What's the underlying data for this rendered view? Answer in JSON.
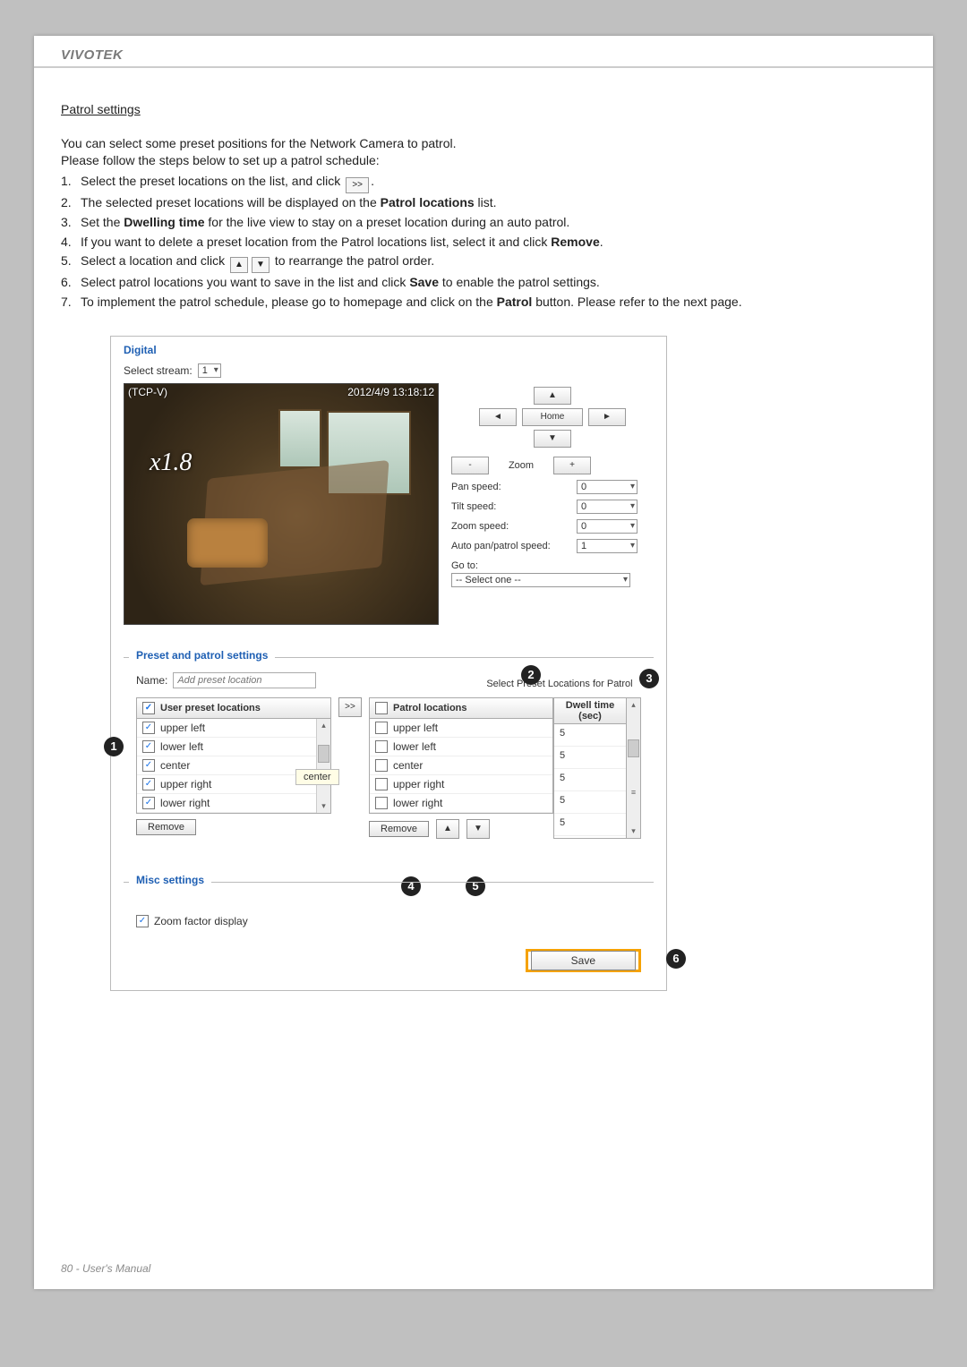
{
  "brand": "VIVOTEK",
  "footer": "80 - User's Manual",
  "title": "Patrol settings",
  "intro1": "You can select some preset positions for the Network Camera to patrol.",
  "intro2": "Please follow the steps below to set up a patrol schedule:",
  "steps": {
    "s1a": "Select the preset locations on the list, and click ",
    "s1b": ".",
    "s2a": "The selected preset locations will be displayed on the ",
    "s2b": "Patrol locations",
    "s2c": " list.",
    "s3a": "Set the ",
    "s3b": "Dwelling time",
    "s3c": " for the live view to stay on a preset location during an auto patrol.",
    "s4a": "If you want to delete a preset location from the Patrol locations list, select it and click ",
    "s4b": "Remove",
    "s4c": ".",
    "s5a": "Select a location and click ",
    "s5b": " to rearrange the patrol order.",
    "s6a": "Select patrol locations you want to save in the list and click ",
    "s6b": "Save",
    "s6c": " to enable the patrol settings.",
    "s7a": "To implement the patrol schedule, please go to homepage and click on the ",
    "s7b": "Patrol",
    "s7c": " button. Please refer to the next page."
  },
  "nums": {
    "n1": "1.",
    "n2": "2.",
    "n3": "3.",
    "n4": "4.",
    "n5": "5.",
    "n6": "6.",
    "n7": "7."
  },
  "shot": {
    "tab": "Digital",
    "selectStreamLbl": "Select stream:",
    "selectStreamVal": "1",
    "overlayLeft": "(TCP-V)",
    "overlayRight": "2012/4/9 13:18:12",
    "zoomOverlay": "x1.8",
    "homeBtn": "Home",
    "zoomLabel": "Zoom",
    "speeds": {
      "pan": {
        "lbl": "Pan speed:",
        "val": "0"
      },
      "tilt": {
        "lbl": "Tilt speed:",
        "val": "0"
      },
      "zoom": {
        "lbl": "Zoom speed:",
        "val": "0"
      },
      "auto": {
        "lbl": "Auto pan/patrol speed:",
        "val": "1"
      }
    },
    "gotoLbl": "Go to:",
    "gotoVal": "-- Select one --",
    "presetLegend": "Preset and patrol settings",
    "nameLbl": "Name:",
    "namePlaceholder": "Add preset location",
    "patrolLabel": "Select Preset Locations for Patrol",
    "userHead": "User preset locations",
    "patrolHead": "Patrol locations",
    "dwellHead1": "Dwell time",
    "dwellHead2": "(sec)",
    "user_presets": [
      "upper left",
      "lower left",
      "center",
      "upper right",
      "lower right"
    ],
    "patrol_locations": [
      {
        "name": "upper left",
        "dwell": "5"
      },
      {
        "name": "lower left",
        "dwell": "5"
      },
      {
        "name": "center",
        "dwell": "5"
      },
      {
        "name": "upper right",
        "dwell": "5"
      },
      {
        "name": "lower right",
        "dwell": "5"
      }
    ],
    "tooltip": "center",
    "removeBtn": "Remove",
    "miscLegend": "Misc settings",
    "miscCheck": "Zoom factor display",
    "saveBtn": "Save",
    "markers": {
      "m1": "1",
      "m2": "2",
      "m3": "3",
      "m4": "4",
      "m5": "5",
      "m6": "6"
    },
    "glyph": {
      "shift": ">>",
      "up": "▲",
      "down": "▼",
      "left": "◄",
      "right": "►",
      "minus": "-",
      "plus": "+"
    }
  }
}
